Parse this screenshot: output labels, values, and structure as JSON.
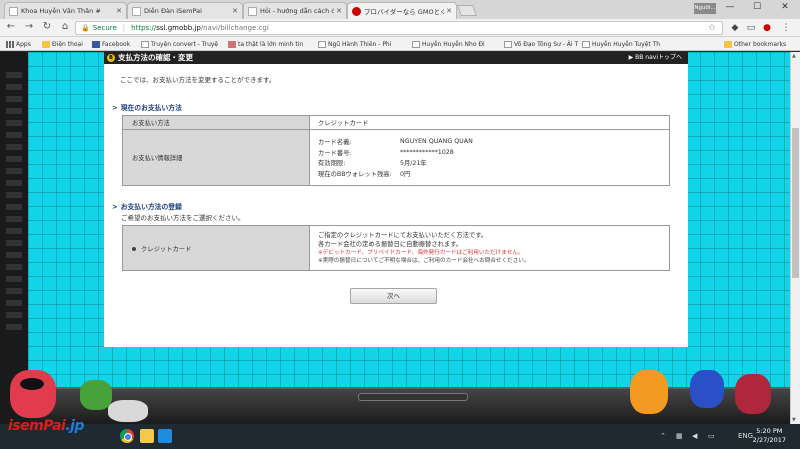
{
  "browser": {
    "tabs": [
      {
        "label": "Khoa Huyễn Vấn Thân #",
        "active": false
      },
      {
        "label": "Diễn Đàn iSemPai",
        "active": false
      },
      {
        "label": "Hỏi - hướng dẫn cách đă",
        "active": false
      },
      {
        "label": "プロバイダーなら GMOとくと",
        "active": true
      }
    ],
    "user_badge": "Người...",
    "window_controls": {
      "minimize": "—",
      "maximize": "☐",
      "close": "✕"
    },
    "address": {
      "secure_label": "Secure",
      "url_scheme": "https://",
      "url_host": "ssl.gmobb.jp",
      "url_path": "/navi/billchange.cgi"
    },
    "bookmarks": [
      "Apps",
      "Điện thoại",
      "Facebook",
      "Truyện convert - Truyệ",
      "ta thật là lớn minh tin",
      "Ngũ Hành Thiên - Phi",
      "Huyễn Huyễn Nho Đi",
      "Võ Đạo Tông Sư - Ái T",
      "Huyễn Huyễn Tuyệt Th"
    ],
    "other_bookmarks": "Other bookmarks"
  },
  "page": {
    "header_title": "支払方法の確認・変更",
    "header_link": "▶ BB naviトップへ",
    "intro": "ここでは、お支払い方法を変更することができます。",
    "current_section": {
      "title": "現在のお支払い方法",
      "method_label": "お支払い方法",
      "method_value": "クレジットカード",
      "detail_label": "お支払い情報詳細",
      "details": [
        {
          "k": "カード名義:",
          "v": "NGUYEN QUANG QUAN"
        },
        {
          "k": "カード番号:",
          "v": "************1028"
        },
        {
          "k": "有効期限:",
          "v": "5月/21年"
        },
        {
          "k": "現在のBBウォレット残高:",
          "v": "0円"
        }
      ]
    },
    "register_section": {
      "title": "お支払い方法の登録",
      "desc": "ご希望のお支払い方法をご選択ください。",
      "option_label": "クレジットカード",
      "option_desc_1": "ご指定のクレジットカードにてお支払いいただく方法です。",
      "option_desc_2": "各カード会社の定める振替日に自動振替されます。",
      "note_red": "※デビットカード、プリペイドカード、海外発行カードはご利用いただけません。",
      "note_black": "※実際の振替日についてご不明な場合は、ご利用のカード会社へお問合せください。"
    },
    "next_button": "次へ"
  },
  "taskbar": {
    "logo_main": "isemPai",
    "logo_suffix": ".jp",
    "language": "ENG",
    "time": "5:20 PM",
    "date": "2/27/2017"
  }
}
